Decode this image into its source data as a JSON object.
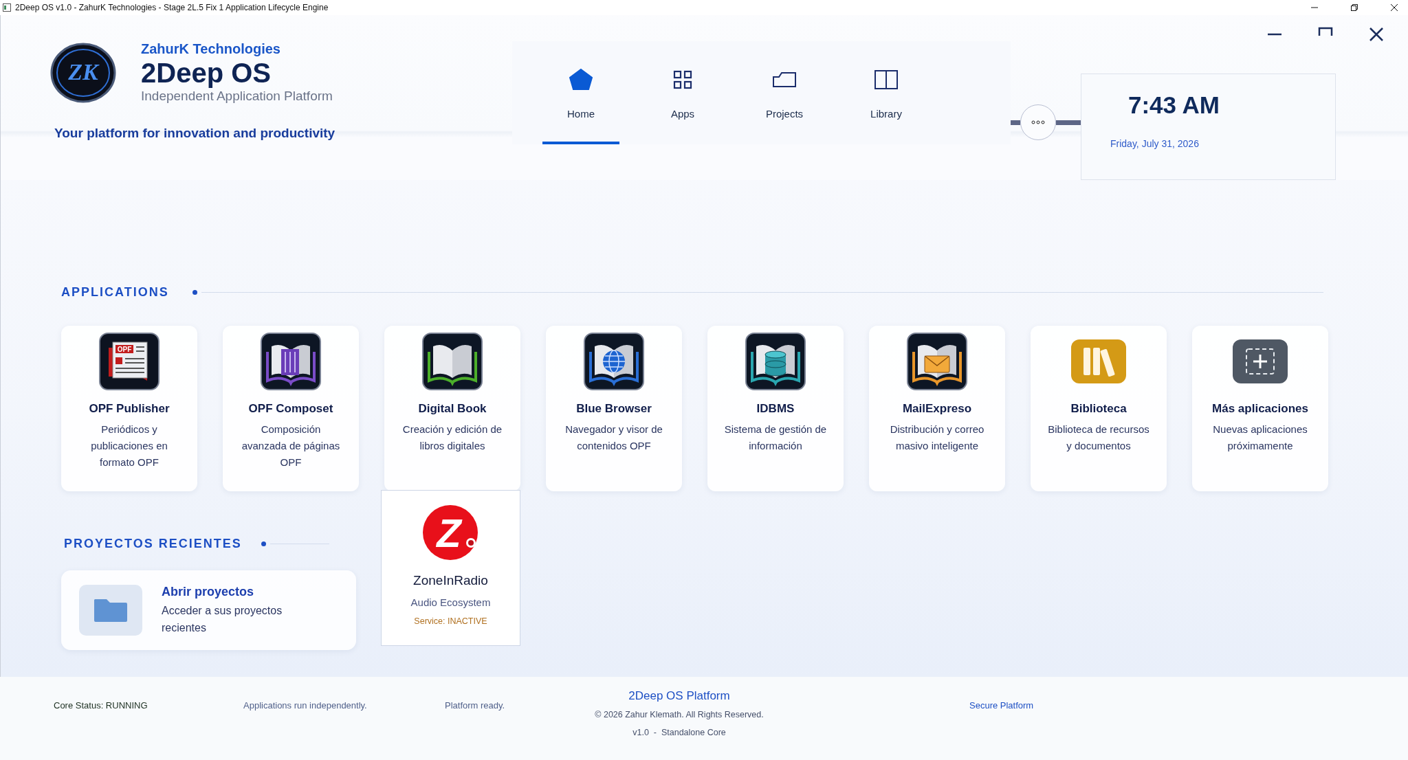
{
  "window": {
    "title": "2Deep OS v1.0 - ZahurK Technologies - Stage 2L.5 Fix 1 Application Lifecycle Engine"
  },
  "header": {
    "logo_monogram": "ZK",
    "company": "ZahurK Technologies",
    "product": "2Deep OS",
    "subtitle": "Independent Application Platform",
    "tagline": "Your platform for innovation and productivity"
  },
  "nav_tabs": [
    {
      "kind": "home",
      "label": "Home",
      "selected": true
    },
    {
      "kind": "apps",
      "label": "Apps",
      "selected": false
    },
    {
      "kind": "projects",
      "label": "Projects",
      "selected": false
    },
    {
      "kind": "library",
      "label": "Library",
      "selected": false
    }
  ],
  "clock": {
    "time": "7:43 AM",
    "date": "Friday, July 31, 2026"
  },
  "applications": {
    "title": "APPLICATIONS",
    "items": [
      {
        "kind": "publisher",
        "badge": "OPF",
        "name": "OPF Publisher",
        "description": "Periódicos y publicaciones en formato OPF"
      },
      {
        "kind": "composer",
        "name": "OPF Composet",
        "description": "Composición avanzada de páginas OPF"
      },
      {
        "kind": "book",
        "name": "Digital Book",
        "description": "Creación y edición de libros digitales"
      },
      {
        "kind": "browser",
        "name": "Blue Browser",
        "description": "Navegador y visor de contenidos OPF"
      },
      {
        "kind": "database",
        "name": "IDBMS",
        "description": "Sistema de gestión de información"
      },
      {
        "kind": "mail",
        "name": "MailExpreso",
        "description": "Distribución y correo masivo inteligente"
      },
      {
        "kind": "binders",
        "name": "Biblioteca",
        "description": "Biblioteca de recursos y documentos"
      },
      {
        "kind": "add",
        "name": "Más aplicaciones",
        "description": "Nuevas aplicaciones próximamente"
      }
    ]
  },
  "recent_projects": {
    "title": "PROYECTOS RECIENTES",
    "card": {
      "title": "Abrir proyectos",
      "description": "Acceder a sus proyectos recientes"
    }
  },
  "app_panel": {
    "logo_letter": "Z",
    "name": "ZoneInRadio",
    "subtitle": "Audio Ecosystem",
    "status": "Service: INACTIVE"
  },
  "footer": {
    "core_status": "Core Status: RUNNING",
    "apps_note": "Applications run independently.",
    "platform_note": "Platform ready.",
    "title": "2Deep OS Platform",
    "copyright": "© 2026 Zahur Klemath. All Rights Reserved.",
    "version": "v1.0  -  Standalone Core",
    "secure": "Secure Platform"
  }
}
